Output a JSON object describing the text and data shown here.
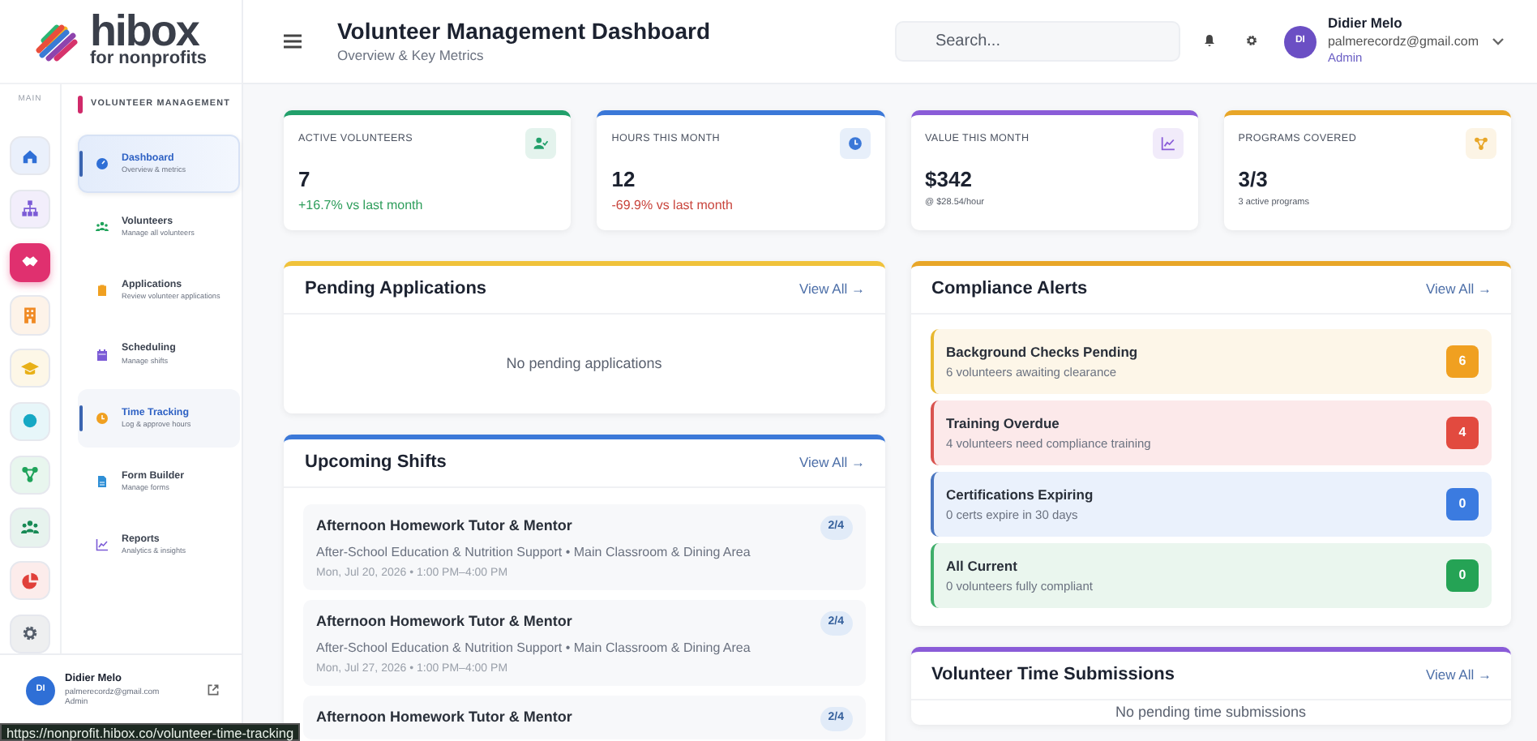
{
  "logo": {
    "name": "hibox",
    "tagline": "for nonprofits"
  },
  "rail": {
    "label": "MAIN",
    "items": [
      {
        "color": "#2f6fd6",
        "selected": false
      },
      {
        "color": "#7b5bd6",
        "selected": false
      },
      {
        "color": "#e0306f",
        "selected": true
      },
      {
        "color": "#f08a24",
        "selected": false
      },
      {
        "color": "#e8b018",
        "selected": false
      },
      {
        "color": "#16a8c4",
        "selected": false
      },
      {
        "color": "#1fa35a",
        "selected": false
      },
      {
        "color": "#178a55",
        "selected": false
      },
      {
        "color": "#e0403a",
        "selected": false
      },
      {
        "color": "#555e6b",
        "selected": false
      }
    ]
  },
  "sidebar": {
    "section": "VOLUNTEER MANAGEMENT",
    "items": [
      {
        "color": "#2f6fd6",
        "label": "Dashboard",
        "sub": "Overview & metrics",
        "selected": true,
        "hovered": false
      },
      {
        "color": "#1fa35a",
        "label": "Volunteers",
        "sub": "Manage all volunteers",
        "selected": false,
        "hovered": false
      },
      {
        "color": "#f0a020",
        "label": "Applications",
        "sub": "Review volunteer applications",
        "selected": false,
        "hovered": false
      },
      {
        "color": "#7b5bd6",
        "label": "Scheduling",
        "sub": "Manage shifts",
        "selected": false,
        "hovered": false
      },
      {
        "color": "#f0a020",
        "label": "Time Tracking",
        "sub": "Log & approve hours",
        "selected": false,
        "hovered": true
      },
      {
        "color": "#2f8fd6",
        "label": "Form Builder",
        "sub": "Manage forms",
        "selected": false,
        "hovered": false
      },
      {
        "color": "#7b5bd6",
        "label": "Reports",
        "sub": "Analytics & insights",
        "selected": false,
        "hovered": false
      }
    ]
  },
  "sidebar_user": {
    "initials": "DI",
    "name": "Didier Melo",
    "email": "palmerecordz@gmail.com",
    "role": "Admin"
  },
  "header": {
    "title": "Volunteer Management Dashboard",
    "subtitle": "Overview & Key Metrics",
    "search": {
      "placeholder": "Search..."
    },
    "user": {
      "initials": "DI",
      "name": "Didier Melo",
      "email": "palmerecordz@gmail.com",
      "role": "Admin"
    }
  },
  "stats": [
    {
      "label": "ACTIVE VOLUNTEERS",
      "value": "7",
      "note": "+16.7% vs last month",
      "kind": "up",
      "color": "#22a06b"
    },
    {
      "label": "HOURS THIS MONTH",
      "value": "12",
      "note": "-69.9% vs last month",
      "kind": "down",
      "color": "#3b78d8"
    },
    {
      "label": "VALUE THIS MONTH",
      "value": "$342",
      "note": "@ $28.54/hour",
      "kind": "note",
      "color": "#8a5cd8"
    },
    {
      "label": "PROGRAMS COVERED",
      "value": "3/3",
      "note": "3 active programs",
      "kind": "note",
      "color": "#e8a628"
    }
  ],
  "pending_applications": {
    "title": "Pending Applications",
    "link": "View All →",
    "color": "#f0c23a",
    "empty": "No pending applications"
  },
  "upcoming_shifts": {
    "title": "Upcoming Shifts",
    "link": "View All →",
    "color": "#3b78d8",
    "items": [
      {
        "title": "Afternoon Homework Tutor & Mentor",
        "place": "After-School Education & Nutrition Support • Main Classroom & Dining Area",
        "when": "Mon, Jul 20, 2026 • 1:00 PM–4:00 PM",
        "count": "2/4"
      },
      {
        "title": "Afternoon Homework Tutor & Mentor",
        "place": "After-School Education & Nutrition Support • Main Classroom & Dining Area",
        "when": "Mon, Jul 27, 2026 • 1:00 PM–4:00 PM",
        "count": "2/4"
      },
      {
        "title": "Afternoon Homework Tutor & Mentor",
        "count": "2/4"
      }
    ]
  },
  "compliance_alerts": {
    "title": "Compliance Alerts",
    "link": "View All →",
    "color": "#e8a628",
    "items": [
      {
        "kind": "warning",
        "title": "Background Checks Pending",
        "text": "6 volunteers awaiting clearance",
        "count": "6"
      },
      {
        "kind": "danger",
        "title": "Training Overdue",
        "text": "4 volunteers need compliance training",
        "count": "4"
      },
      {
        "kind": "info",
        "title": "Certifications Expiring",
        "text": "0 certs expire in 30 days",
        "count": "0"
      },
      {
        "kind": "success",
        "title": "All Current",
        "text": "0 volunteers fully compliant",
        "count": "0"
      }
    ]
  },
  "time_submissions": {
    "title": "Volunteer Time Submissions",
    "link": "View All →",
    "color": "#8a5cd8",
    "empty": "No pending time submissions"
  },
  "status_bar": {
    "url": "https://nonprofit.hibox.co/volunteer-time-tracking"
  }
}
